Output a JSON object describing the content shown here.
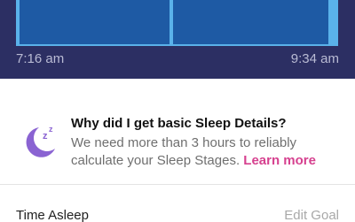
{
  "graph": {
    "start_time": "7:16 am",
    "end_time": "9:34 am"
  },
  "info": {
    "icon": "moon-zz-icon",
    "title": "Why did I get basic Sleep Details?",
    "body": "We need more than 3 hours to reliably calculate your Sleep Stages.",
    "link": "Learn more",
    "accent_color": "#8a63d2",
    "link_color": "#d6418f"
  },
  "section": {
    "label": "Time Asleep",
    "action": "Edit Goal"
  }
}
